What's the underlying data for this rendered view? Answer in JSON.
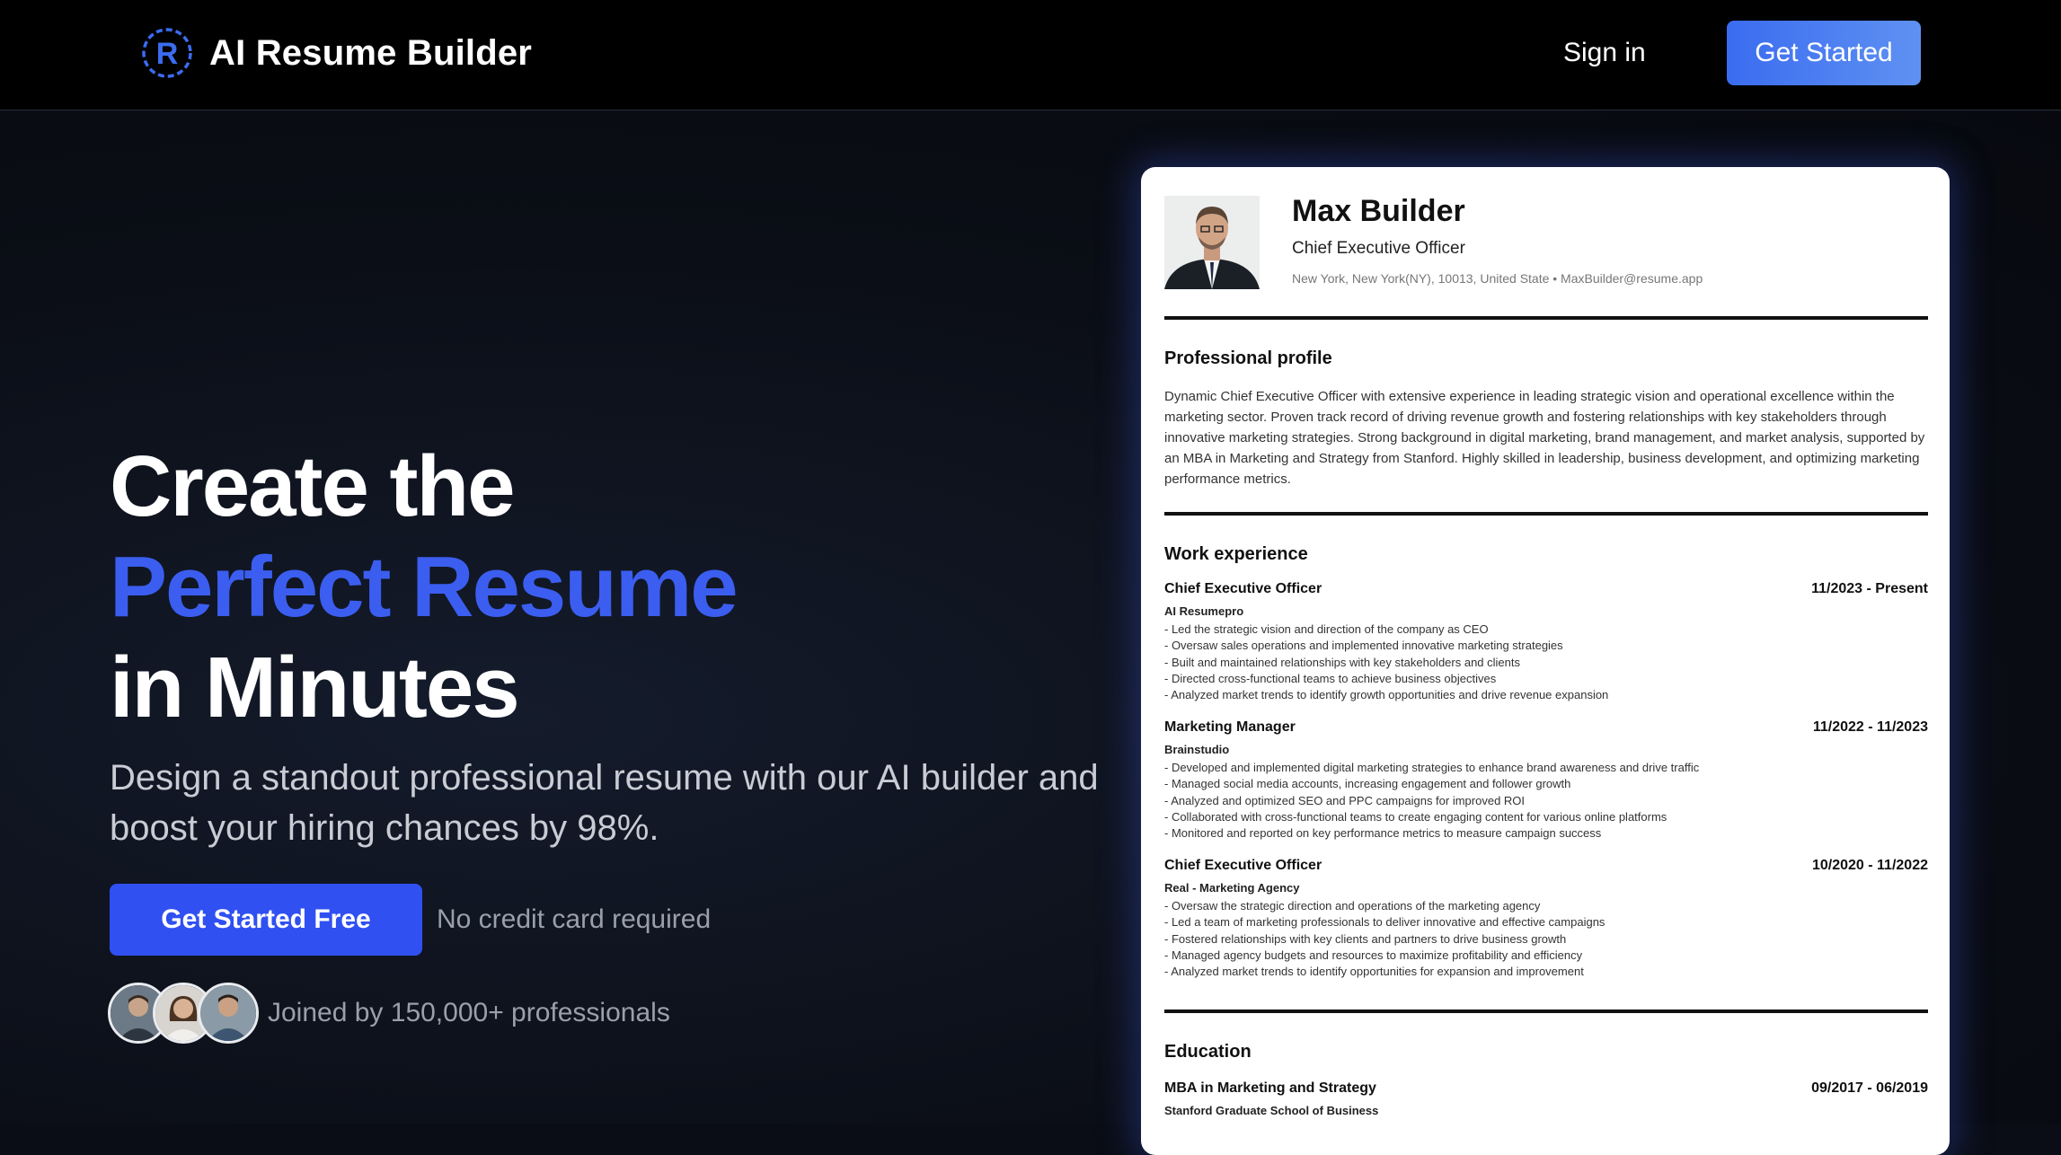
{
  "header": {
    "brand": "AI Resume Builder",
    "brand_letter": "R",
    "sign_in": "Sign in",
    "get_started": "Get Started"
  },
  "hero": {
    "line1": "Create the",
    "line2": "Perfect Resume",
    "line3": "in Minutes",
    "subtitle": "Design a standout professional resume with our AI builder and boost your hiring chances by 98%.",
    "cta": "Get Started Free",
    "no_credit": "No credit card required",
    "joined": "Joined by 150,000+ professionals"
  },
  "colors": {
    "accent": "#3b5ef0",
    "header_button": "#4a78f1",
    "background": "#0a0d15"
  },
  "resume": {
    "name": "Max Builder",
    "title": "Chief Executive Officer",
    "contact": "New York, New York(NY), 10013, United State • MaxBuilder@resume.app",
    "profile_heading": "Professional profile",
    "profile": "Dynamic Chief Executive Officer with extensive experience in leading strategic vision and operational excellence within the marketing sector. Proven track record of driving revenue growth and fostering relationships with key stakeholders through innovative marketing strategies. Strong background in digital marketing, brand management, and market analysis, supported by an MBA in Marketing and Strategy from Stanford. Highly skilled in leadership, business development, and optimizing marketing performance metrics.",
    "work_heading": "Work experience",
    "jobs": [
      {
        "title": "Chief Executive Officer",
        "dates": "11/2023 - Present",
        "company": "AI Resumepro",
        "bullets": [
          "- Led the strategic vision and direction of the company as CEO",
          "- Oversaw sales operations and implemented innovative marketing strategies",
          "- Built and maintained relationships with key stakeholders and clients",
          "- Directed cross-functional teams to achieve business objectives",
          "- Analyzed market trends to identify growth opportunities and drive revenue expansion"
        ]
      },
      {
        "title": "Marketing Manager",
        "dates": "11/2022 - 11/2023",
        "company": "Brainstudio",
        "bullets": [
          "- Developed and implemented digital marketing strategies to enhance brand awareness and drive traffic",
          "- Managed social media accounts, increasing engagement and follower growth",
          "- Analyzed and optimized SEO and PPC campaigns for improved ROI",
          "- Collaborated with cross-functional teams to create engaging content for various online platforms",
          "- Monitored and reported on key performance metrics to measure campaign success"
        ]
      },
      {
        "title": "Chief Executive Officer",
        "dates": "10/2020 - 11/2022",
        "company": "Real - Marketing Agency",
        "bullets": [
          "- Oversaw the strategic direction and operations of the marketing agency",
          "- Led a team of marketing professionals to deliver innovative and effective campaigns",
          "- Fostered relationships with key clients and partners to drive business growth",
          "- Managed agency budgets and resources to maximize profitability and efficiency",
          "- Analyzed market trends to identify opportunities for expansion and improvement"
        ]
      }
    ],
    "education_heading": "Education",
    "education": {
      "degree": "MBA in Marketing and Strategy",
      "dates": "09/2017 - 06/2019",
      "school": "Stanford Graduate School of Business"
    }
  }
}
